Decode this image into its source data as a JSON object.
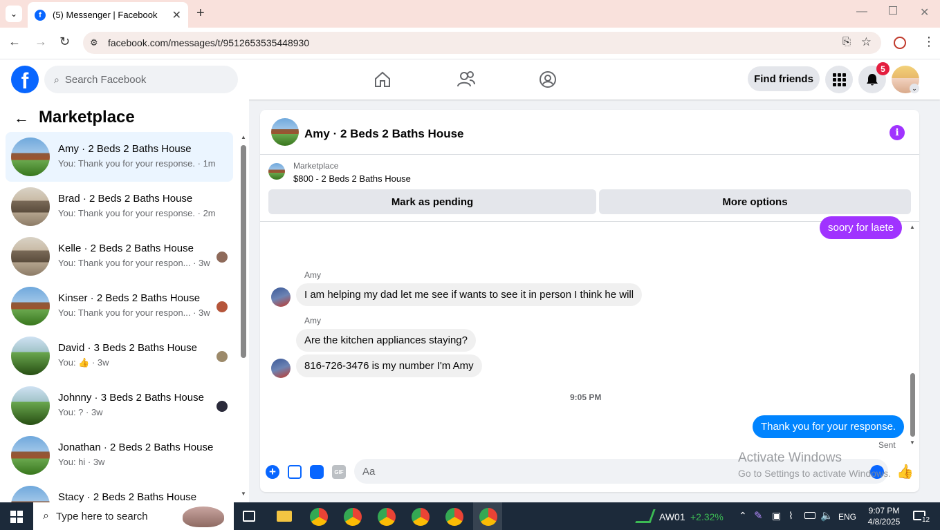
{
  "browser": {
    "tab_title": "(5) Messenger | Facebook",
    "url": "facebook.com/messages/t/9512653535448930"
  },
  "fbnav": {
    "search_placeholder": "Search Facebook",
    "find_friends": "Find friends",
    "notif_count": "5"
  },
  "sidebar": {
    "title": "Marketplace",
    "conversations": [
      {
        "name": "Amy · 2 Beds 2 Baths House",
        "snippet": "You: Thank you for your response. · 1m",
        "selected": true
      },
      {
        "name": "Brad · 2 Beds 2 Baths House",
        "snippet": "You: Thank you for your response. · 2m"
      },
      {
        "name": "Kelle · 2 Beds 2 Baths House",
        "snippet": "You: Thank you for your respon... · 3w"
      },
      {
        "name": "Kinser · 2 Beds 2 Baths House",
        "snippet": "You: Thank you for your respon... · 3w"
      },
      {
        "name": "David · 3 Beds 2 Baths House",
        "snippet": "You: 👍 · 3w"
      },
      {
        "name": "Johnny · 3 Beds 2 Baths House",
        "snippet": "You: ? · 3w"
      },
      {
        "name": "Jonathan · 2 Beds 2 Baths House",
        "snippet": "You: hi · 3w"
      },
      {
        "name": "Stacy · 2 Beds 2 Baths House",
        "snippet": ""
      }
    ]
  },
  "chat": {
    "header_title": "Amy · 2 Beds 2 Baths House",
    "listing_source": "Marketplace",
    "listing_title": "$800 - 2 Beds 2 Baths House",
    "mark_pending": "Mark as pending",
    "more_options": "More options",
    "messages": {
      "m0": "soory for laete",
      "sender1": "Amy",
      "m1": "I am helping my dad let me see if wants to see it in person I think he will",
      "sender2": "Amy",
      "m2": "Are the kitchen appliances staying?",
      "m3": "816-726-3476 is my number I'm Amy",
      "time": "9:05 PM",
      "m4": "Thank you for your response.",
      "status": "Sent"
    },
    "composer_placeholder": "Aa"
  },
  "watermark": {
    "line1": "Activate Windows",
    "line2": "Go to Settings to activate Windows."
  },
  "taskbar": {
    "search_placeholder": "Type here to search",
    "stock_name": "AW01",
    "stock_change": "+2.32%",
    "lang": "ENG",
    "time": "9:07 PM",
    "date": "4/8/2025",
    "notif_count": "12"
  }
}
